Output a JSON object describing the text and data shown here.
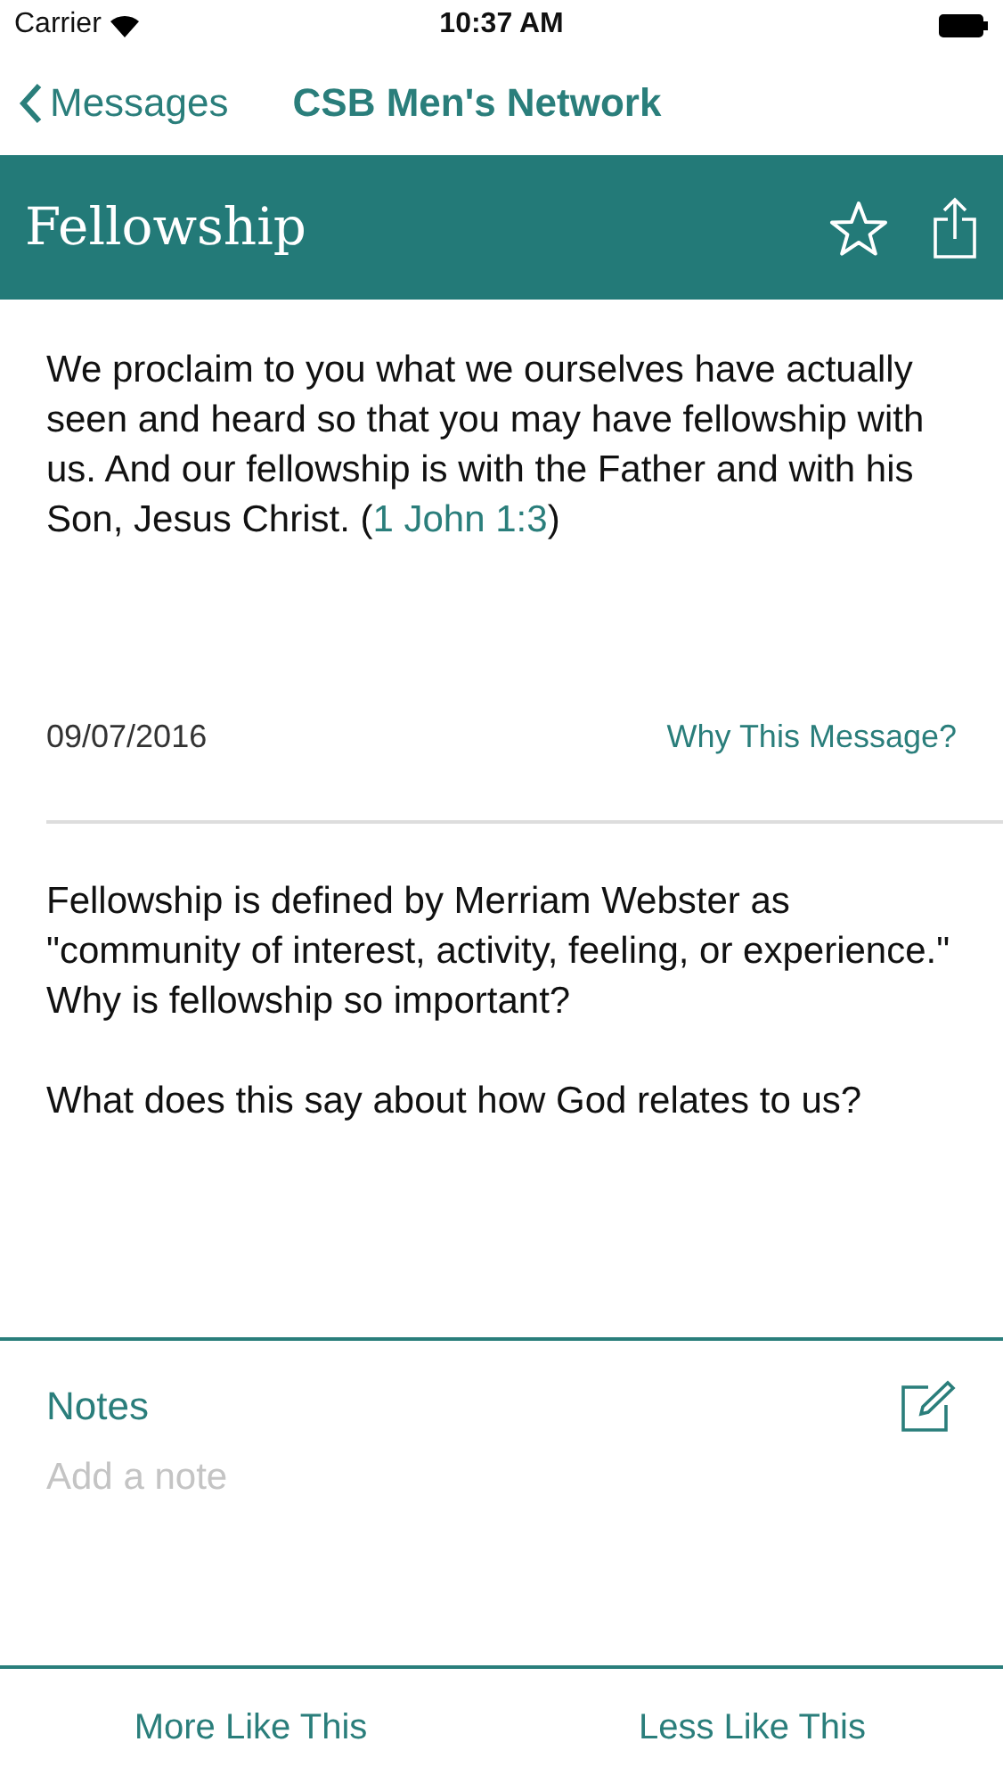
{
  "status_bar": {
    "carrier": "Carrier",
    "time": "10:37 AM"
  },
  "nav": {
    "back": "Messages",
    "title": "CSB Men's Network"
  },
  "header": {
    "title": "Fellowship",
    "starred": false
  },
  "verse": {
    "text_before": "We proclaim to you what we ourselves have actually seen and heard so that you may have fellowship with us. And our fellowship is with the Father and with his Son, Jesus Christ. (",
    "reference": "1 John 1:3",
    "text_after": ")"
  },
  "date": "09/07/2016",
  "why_link": "Why This Message?",
  "body": [
    "Fellowship is defined by Merriam Webster as \"community of interest, activity, feeling, or experience.\"  Why is fellowship so important?",
    "What does this say about how God relates to us?"
  ],
  "notes": {
    "label": "Notes",
    "placeholder": "Add a note"
  },
  "actions": [
    "More Like This",
    "Less Like This"
  ]
}
